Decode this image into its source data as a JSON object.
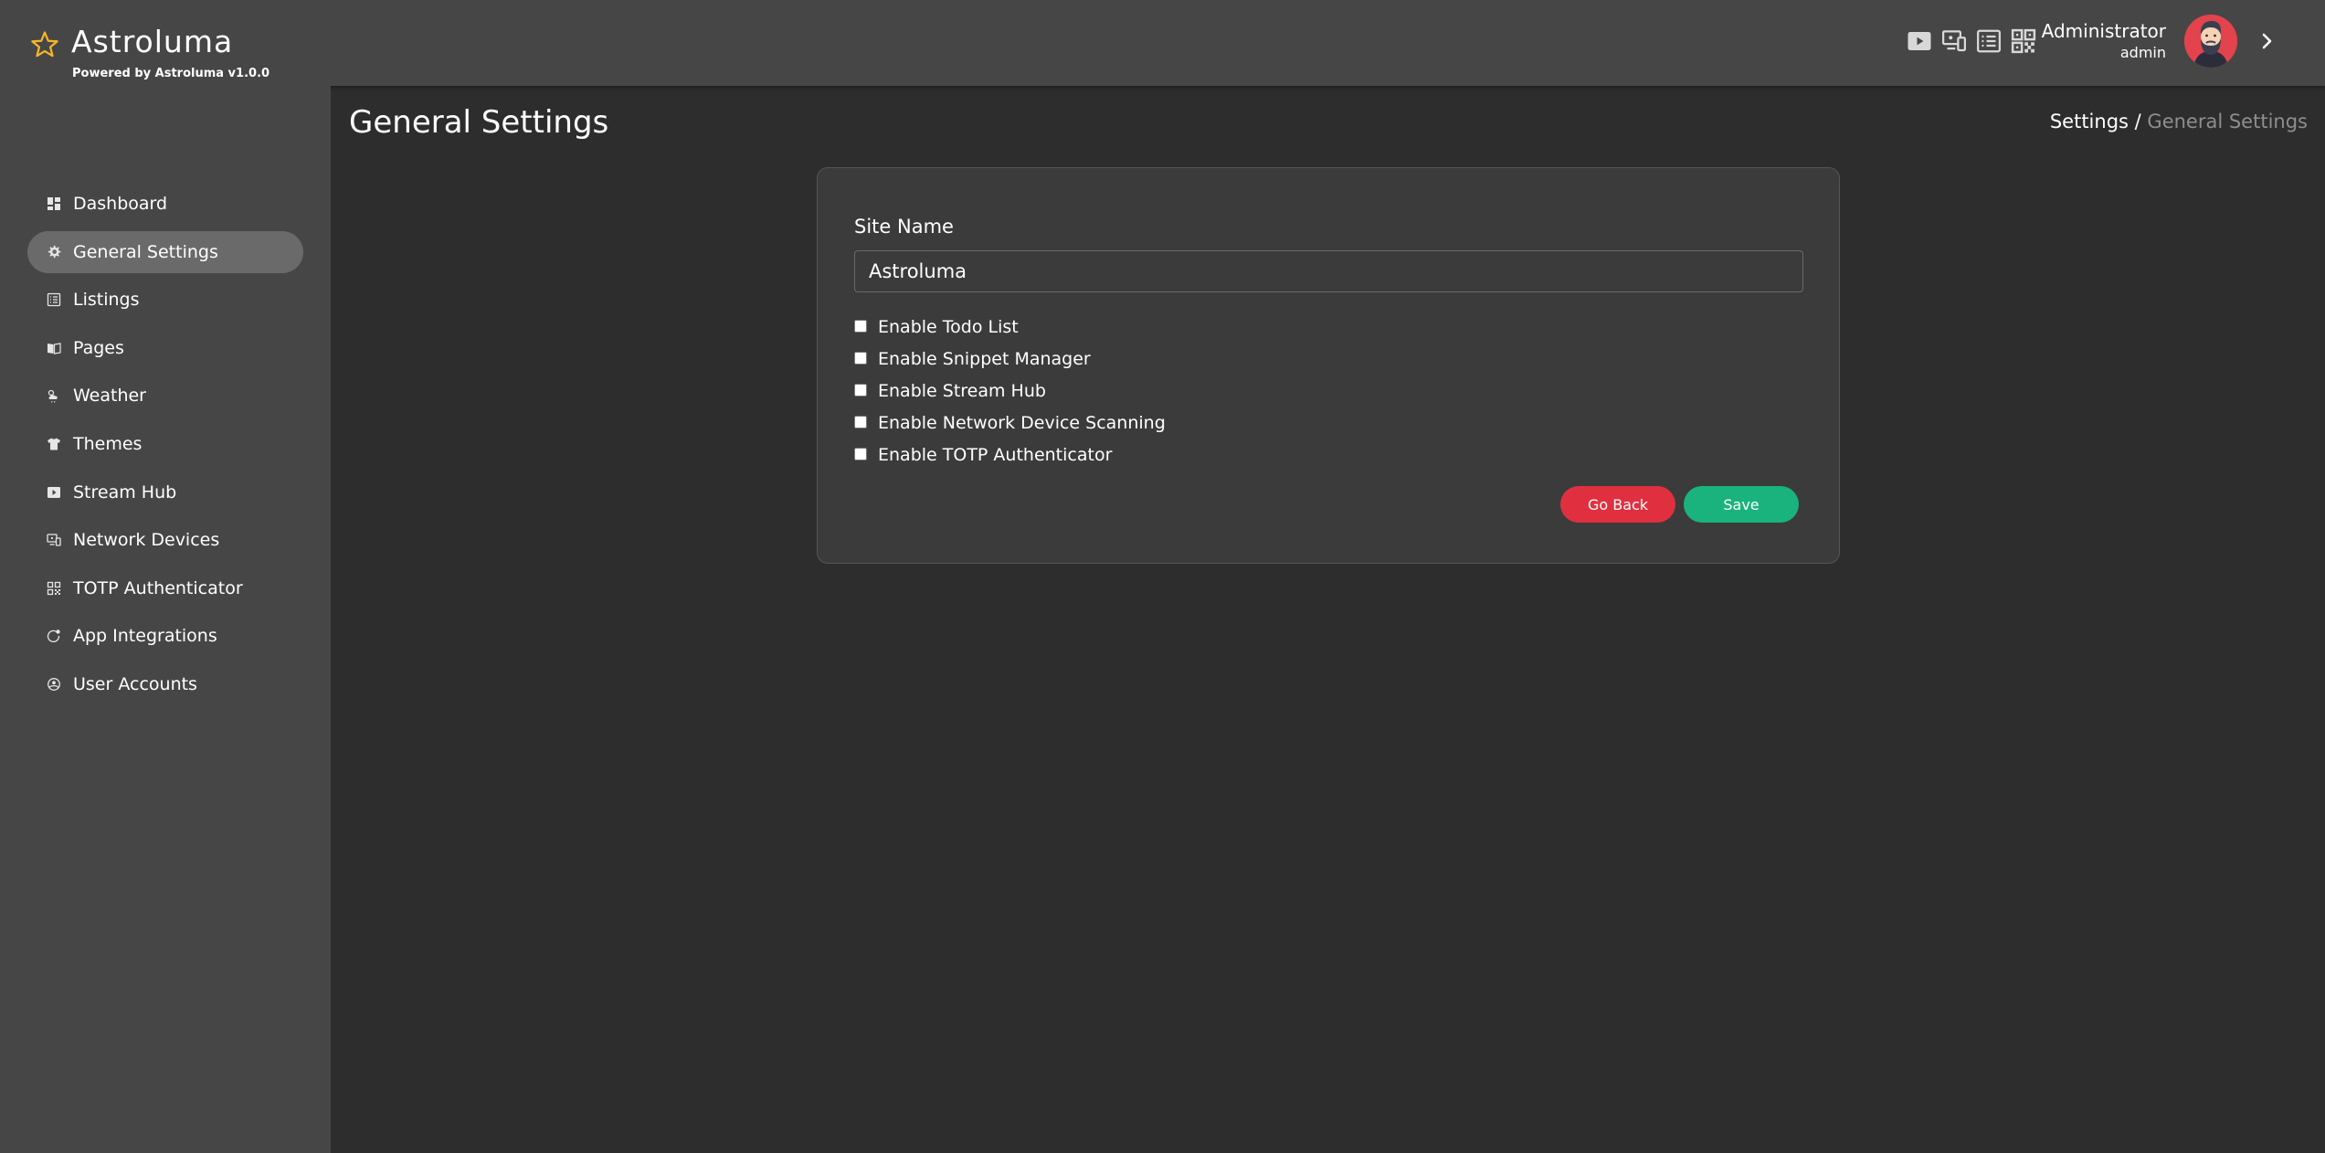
{
  "brand": {
    "title": "Astroluma",
    "subtitle": "Powered by Astroluma v1.0.0",
    "accent": "#f5b52a"
  },
  "header_icons": [
    "stream-hub-icon",
    "network-devices-icon",
    "listings-icon",
    "totp-qr-icon"
  ],
  "user": {
    "name": "Administrator",
    "role": "admin"
  },
  "sidebar": {
    "items": [
      {
        "label": "Dashboard",
        "icon": "dashboard-icon"
      },
      {
        "label": "General Settings",
        "icon": "gear-icon",
        "active": true
      },
      {
        "label": "Listings",
        "icon": "listings-icon"
      },
      {
        "label": "Pages",
        "icon": "pages-icon"
      },
      {
        "label": "Weather",
        "icon": "weather-icon"
      },
      {
        "label": "Themes",
        "icon": "tshirt-icon"
      },
      {
        "label": "Stream Hub",
        "icon": "play-icon"
      },
      {
        "label": "Network Devices",
        "icon": "network-devices-icon"
      },
      {
        "label": "TOTP Authenticator",
        "icon": "qr-icon"
      },
      {
        "label": "App Integrations",
        "icon": "integration-icon"
      },
      {
        "label": "User Accounts",
        "icon": "user-accounts-icon"
      }
    ]
  },
  "page": {
    "title": "General Settings",
    "breadcrumb": {
      "parent": "Settings /",
      "current": "General Settings"
    }
  },
  "form": {
    "site_name_label": "Site Name",
    "site_name_value": "Astroluma",
    "checkboxes": [
      {
        "label": "Enable Todo List",
        "checked": false
      },
      {
        "label": "Enable Snippet Manager",
        "checked": false
      },
      {
        "label": "Enable Stream Hub",
        "checked": false
      },
      {
        "label": "Enable Network Device Scanning",
        "checked": false
      },
      {
        "label": "Enable TOTP Authenticator",
        "checked": false
      }
    ],
    "go_back_label": "Go Back",
    "save_label": "Save",
    "go_back_color": "#e0303f",
    "save_color": "#1ab37e"
  }
}
